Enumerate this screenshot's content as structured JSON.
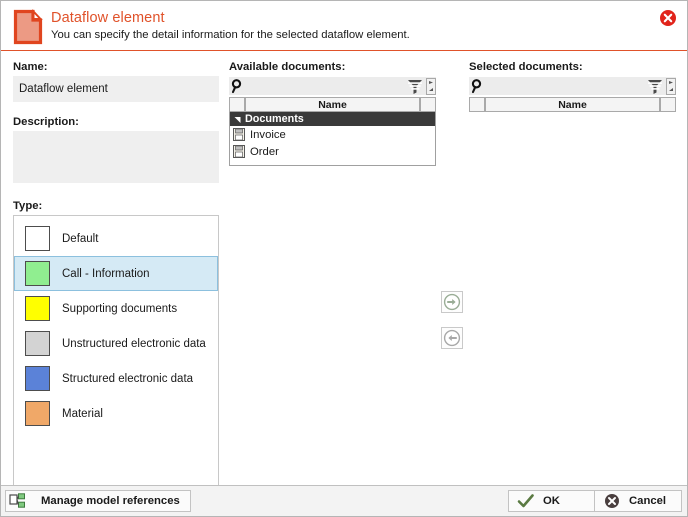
{
  "header": {
    "icon": "document-element-icon",
    "title": "Dataflow element",
    "subtitle": "You can specify the detail information for the selected dataflow element.",
    "close_icon": "close-icon",
    "accent_color": "#e0522a",
    "icon_fill": "#ec9a84",
    "icon_stroke": "#e0451f",
    "close_color": "#e1241b"
  },
  "form": {
    "name_label": "Name:",
    "name_value": "Dataflow element",
    "name_placeholder": "",
    "description_label": "Description:",
    "description_value": "",
    "description_placeholder": "",
    "type_label": "Type:"
  },
  "types": {
    "selected_index": 1,
    "items": [
      {
        "label": "Default",
        "color": "#ffffff"
      },
      {
        "label": "Call - Information",
        "color": "#90ee90"
      },
      {
        "label": "Supporting documents",
        "color": "#ffff00"
      },
      {
        "label": "Unstructured electronic data",
        "color": "#d3d3d3"
      },
      {
        "label": "Structured electronic data",
        "color": "#5b82d8"
      },
      {
        "label": "Material",
        "color": "#f0a868"
      }
    ],
    "selection_background": "#d5eaf5",
    "selection_border": "#8cc0de"
  },
  "available": {
    "label": "Available documents:",
    "search_value": "",
    "search_placeholder": "",
    "search_icon": "search-icon",
    "filter_icon": "filter-funnel-icon",
    "stepper_icon": "stepper-arrows-icon",
    "columns": [
      "",
      "Name",
      ""
    ],
    "groups": [
      {
        "name": "Documents",
        "expanded": true,
        "items": [
          {
            "name": "Invoice",
            "icon": "document-icon"
          },
          {
            "name": "Order",
            "icon": "document-icon"
          }
        ]
      }
    ]
  },
  "selected": {
    "label": "Selected documents:",
    "search_value": "",
    "search_placeholder": "",
    "search_icon": "search-icon",
    "filter_icon": "filter-funnel-icon",
    "stepper_icon": "stepper-arrows-icon",
    "columns": [
      "",
      "Name",
      ""
    ],
    "groups": []
  },
  "transfer": {
    "add_icon": "arrow-right-icon",
    "add_title": "Add to selected documents",
    "remove_icon": "arrow-left-icon",
    "remove_title": "Remove from selected documents",
    "arrow_color": "#9aad96"
  },
  "footer": {
    "manage_label": "Manage model references",
    "manage_icon": "model-references-icon",
    "ok_label": "OK",
    "ok_icon": "check-icon",
    "cancel_label": "Cancel",
    "cancel_icon": "cancel-icon",
    "ok_color": "#5a7a42",
    "cancel_color": "#4a3f3f"
  }
}
